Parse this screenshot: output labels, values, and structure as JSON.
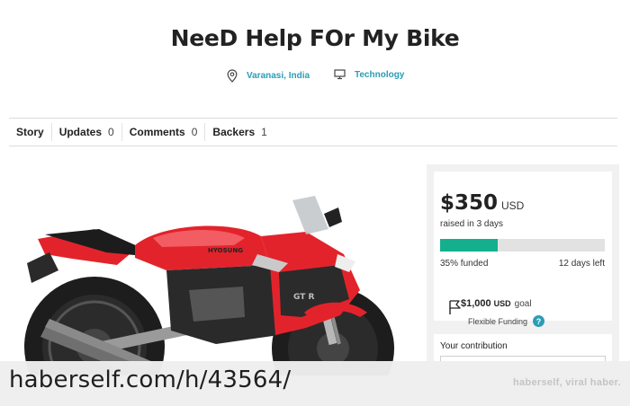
{
  "campaign": {
    "title": "NeeD Help FOr My Bike",
    "location": "Varanasi, India",
    "category": "Technology"
  },
  "tabs": [
    {
      "label": "Story",
      "count": ""
    },
    {
      "label": "Updates",
      "count": "0"
    },
    {
      "label": "Comments",
      "count": "0"
    },
    {
      "label": "Backers",
      "count": "1"
    }
  ],
  "funding": {
    "amount": "$350",
    "currency": "USD",
    "raised_text": "raised in 3 days",
    "progress_fraction": 0.35,
    "funded_text": "35% funded",
    "time_left": "12 days left",
    "goal_amount": "$1,000",
    "goal_currency": "USD",
    "goal_label": "goal",
    "funding_type": "Flexible Funding",
    "help_icon_text": "?"
  },
  "contribution": {
    "label": "Your contribution"
  },
  "watermark": {
    "url": "haberself.com/h/43564/",
    "brand": "haberself, viral haber."
  },
  "colors": {
    "accent": "#2a9db5",
    "progress": "#14b08e",
    "bike_red": "#e3232b"
  },
  "icons": {
    "location": "map-pin-icon",
    "category": "monitor-icon",
    "goal": "flag-icon"
  }
}
